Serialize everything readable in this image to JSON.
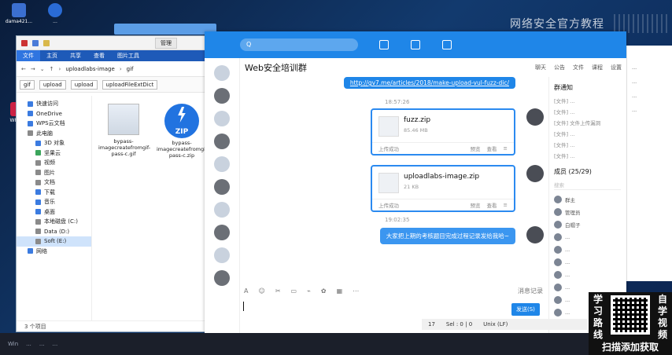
{
  "watermark": "网络安全官方教程",
  "desktop_icons": [
    "dama421...",
    "WPS...",
    "..."
  ],
  "explorer": {
    "manage_button": "管理",
    "ribbon_tabs": [
      "文件",
      "主页",
      "共享",
      "查看",
      "图片工具"
    ],
    "breadcrumb": [
      "uploadlabs-image",
      "gif"
    ],
    "folder_tabs": [
      "gif",
      "upload",
      "upload",
      "uploadFileExtDict"
    ],
    "nav_items": [
      {
        "label": "快速访问",
        "kind": "blue"
      },
      {
        "label": "OneDrive",
        "kind": "blue"
      },
      {
        "label": "WPS云文档",
        "kind": "blue"
      },
      {
        "label": "此电脑",
        "kind": "gray"
      },
      {
        "label": "3D 对象",
        "kind": "blue",
        "sub": true
      },
      {
        "label": "坚果云",
        "kind": "green",
        "sub": true
      },
      {
        "label": "视频",
        "kind": "gray",
        "sub": true
      },
      {
        "label": "图片",
        "kind": "gray",
        "sub": true
      },
      {
        "label": "文档",
        "kind": "gray",
        "sub": true
      },
      {
        "label": "下载",
        "kind": "blue",
        "sub": true
      },
      {
        "label": "音乐",
        "kind": "blue",
        "sub": true
      },
      {
        "label": "桌面",
        "kind": "blue",
        "sub": true
      },
      {
        "label": "本地磁盘 (C:)",
        "kind": "gray",
        "sub": true
      },
      {
        "label": "Data (D:)",
        "kind": "gray",
        "sub": true
      },
      {
        "label": "Soft (E:)",
        "kind": "gray",
        "sub": true,
        "selected": true
      },
      {
        "label": "网络",
        "kind": "blue"
      }
    ],
    "files": [
      {
        "name": "bypass-imagecreatefromgif-pass-c.gif",
        "type": "image"
      },
      {
        "name": "bypass-imagecreatefromgif-pass-c.zip",
        "type": "zip",
        "badge": "ZIP"
      }
    ],
    "status": "3 个项目"
  },
  "chat": {
    "search_placeholder": "Q",
    "group_name": "Web安全培训群",
    "header_menu": [
      "聊天",
      "公告",
      "文件",
      "课程",
      "设置"
    ],
    "link": "http://gv7.me/articles/2018/make-upload-vul-fuzz-dic/",
    "time1": "18:57:26",
    "file1": {
      "name": "fuzz.zip",
      "size": "85.46 MB",
      "status": "上传成功",
      "actions": [
        "预览",
        "查看",
        "≡"
      ]
    },
    "file2": {
      "name": "uploadlabs-image.zip",
      "size": "21 KB",
      "status": "上传成功",
      "actions": [
        "预览",
        "查看",
        "≡"
      ]
    },
    "time2": "19:02:35",
    "message": "大家把上期的考核题目完成过程记录发给我哈~",
    "toolbar": [
      "A",
      "☺",
      "✂",
      "▭",
      "⌁",
      "✿",
      "▦",
      "⋯"
    ],
    "history": "消息记录",
    "send_button": "发送(S)"
  },
  "right_panel": {
    "notice_title": "群通知",
    "notices": [
      "[文件] ...",
      "[文件] ...",
      "[文件] 文件上传漏洞",
      "[文件] ...",
      "[文件] ...",
      "[文件] ..."
    ],
    "members_title": "成员 (25/29)",
    "search_hint": "搜索",
    "members": [
      "群主",
      "管理员",
      "白帽子",
      "...",
      "...",
      "...",
      "...",
      "...",
      "...",
      "..."
    ]
  },
  "side_window": {
    "lines": [
      "...",
      "...",
      "...",
      "..."
    ]
  },
  "statusbar": [
    "17",
    "Sel : 0 | 0",
    "Unix (LF)"
  ],
  "taskbar": [
    "Win",
    "...",
    "...",
    "..."
  ],
  "promo": {
    "left": [
      "学",
      "习",
      "路",
      "线"
    ],
    "right": [
      "自",
      "学",
      "视",
      "频"
    ],
    "bottom": "扫描添加获取"
  }
}
